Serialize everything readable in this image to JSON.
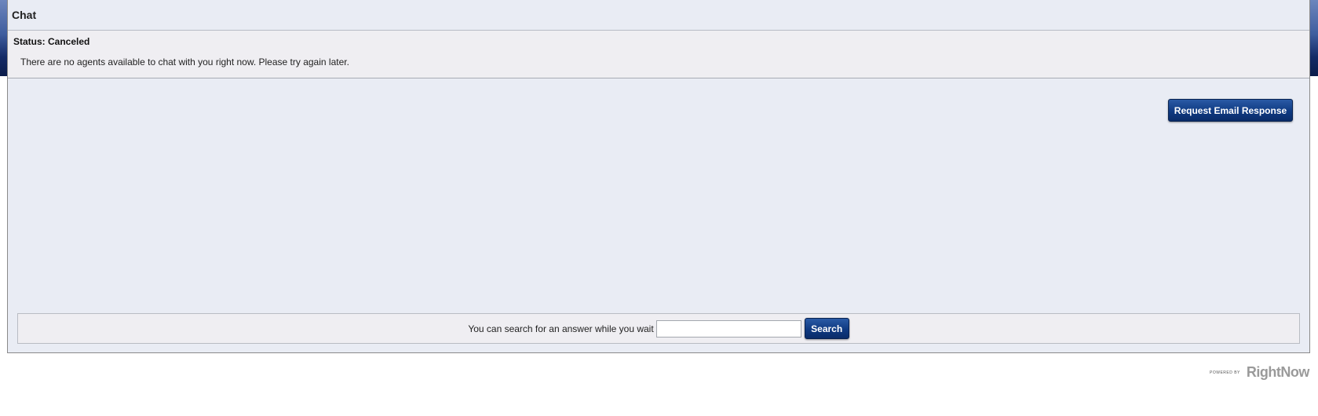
{
  "window": {
    "title": "Chat"
  },
  "status": {
    "label": "Status: Canceled",
    "message": "There are no agents available to chat with you right now. Please try again later."
  },
  "actions": {
    "email_button_label": "Request Email Response"
  },
  "search": {
    "prompt": "You can search for an answer while you wait",
    "input_value": "",
    "button_label": "Search"
  },
  "footer": {
    "powered_by": "POWERED BY",
    "brand": "RightNow"
  },
  "colors": {
    "button_blue": "#0f3a82",
    "header_dark": "#0b1c4a",
    "panel_bg": "#e9ecf4"
  }
}
